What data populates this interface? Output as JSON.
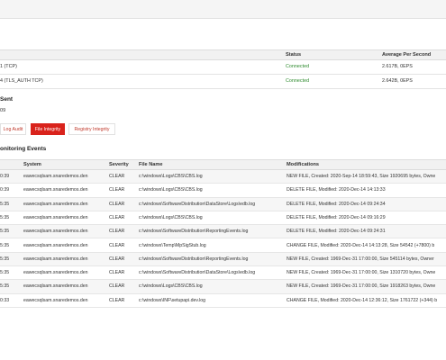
{
  "destinations": {
    "columns": {
      "status": "Status",
      "average": "Average Per Second"
    },
    "rows": [
      {
        "name": "1 (TCP)",
        "status": "Connected",
        "average": "2.617B, 0EPS"
      },
      {
        "name": "4 (TLS_AUTH TCP)",
        "status": "Connected",
        "average": "2.642B, 0EPS"
      }
    ]
  },
  "sent": {
    "title": "Sent",
    "value": "09"
  },
  "tabs": [
    {
      "label": "Log Audit",
      "active": false
    },
    {
      "label": "File Integrity",
      "active": true
    },
    {
      "label": "Registry Integrity",
      "active": false
    }
  ],
  "events": {
    "title": "onitoring Events",
    "columns": {
      "system": "System",
      "severity": "Severity",
      "file": "File Name",
      "modifications": "Modifications"
    },
    "rows": [
      {
        "time": "0:39",
        "system": "eawecsqlsam.snaredemos.den",
        "severity": "CLEAR",
        "file": "c:\\windows\\Logs\\CBS\\CBS.log",
        "mod": "NEW FILE, Created: 2020-Sep-14 18:59:43, Size 1920695 bytes, Owne"
      },
      {
        "time": "0:39",
        "system": "eawecsqlsam.snaredemos.den",
        "severity": "CLEAR",
        "file": "c:\\windows\\Logs\\CBS\\CBS.log",
        "mod": "DELETE FILE, Modified: 2020-Dec-14 14:13:33"
      },
      {
        "time": "5:35",
        "system": "eawecsqlsam.snaredemos.den",
        "severity": "CLEAR",
        "file": "c:\\windows\\SoftwareDistribution\\DataStore\\Logs\\edb.log",
        "mod": "DELETE FILE, Modified: 2020-Dec-14 09:24:34"
      },
      {
        "time": "5:35",
        "system": "eawecsqlsam.snaredemos.den",
        "severity": "CLEAR",
        "file": "c:\\windows\\Logs\\CBS\\CBS.log",
        "mod": "DELETE FILE, Modified: 2020-Dec-14 09:16:29"
      },
      {
        "time": "5:35",
        "system": "eawecsqlsam.snaredemos.den",
        "severity": "CLEAR",
        "file": "c:\\windows\\SoftwareDistribution\\ReportingEvents.log",
        "mod": "DELETE FILE, Modified: 2020-Dec-14 09:24:31"
      },
      {
        "time": "5:35",
        "system": "eawecsqlsam.snaredemos.den",
        "severity": "CLEAR",
        "file": "c:\\windows\\Temp\\MpSigStub.log",
        "mod": "CHANGE FILE, Modified: 2020-Dec-14 14:13:28, Size 54542 (+7800) b"
      },
      {
        "time": "5:35",
        "system": "eawecsqlsam.snaredemos.den",
        "severity": "CLEAR",
        "file": "c:\\windows\\SoftwareDistribution\\ReportingEvents.log",
        "mod": "NEW FILE, Created: 1969-Dec-31 17:00:00, Size 545114 bytes, Owner"
      },
      {
        "time": "5:35",
        "system": "eawecsqlsam.snaredemos.den",
        "severity": "CLEAR",
        "file": "c:\\windows\\SoftwareDistribution\\DataStore\\Logs\\edb.log",
        "mod": "NEW FILE, Created: 1969-Dec-31 17:00:00, Size 1310720 bytes, Owne"
      },
      {
        "time": "5:35",
        "system": "eawecsqlsam.snaredemos.den",
        "severity": "CLEAR",
        "file": "c:\\windows\\Logs\\CBS\\CBS.log",
        "mod": "NEW FILE, Created: 1969-Dec-31 17:00:00, Size 1918263 bytes, Owne"
      },
      {
        "time": "0:33",
        "system": "eawecsqlsam.snaredemos.den",
        "severity": "CLEAR",
        "file": "c:\\windows\\INF\\setupapi.dev.log",
        "mod": "CHANGE FILE, Modified: 2020-Dec-14 12:36:12, Size 1761722 (+344) b"
      }
    ]
  },
  "colors": {
    "accent": "#d9231c",
    "connected": "#2e8b2e"
  }
}
